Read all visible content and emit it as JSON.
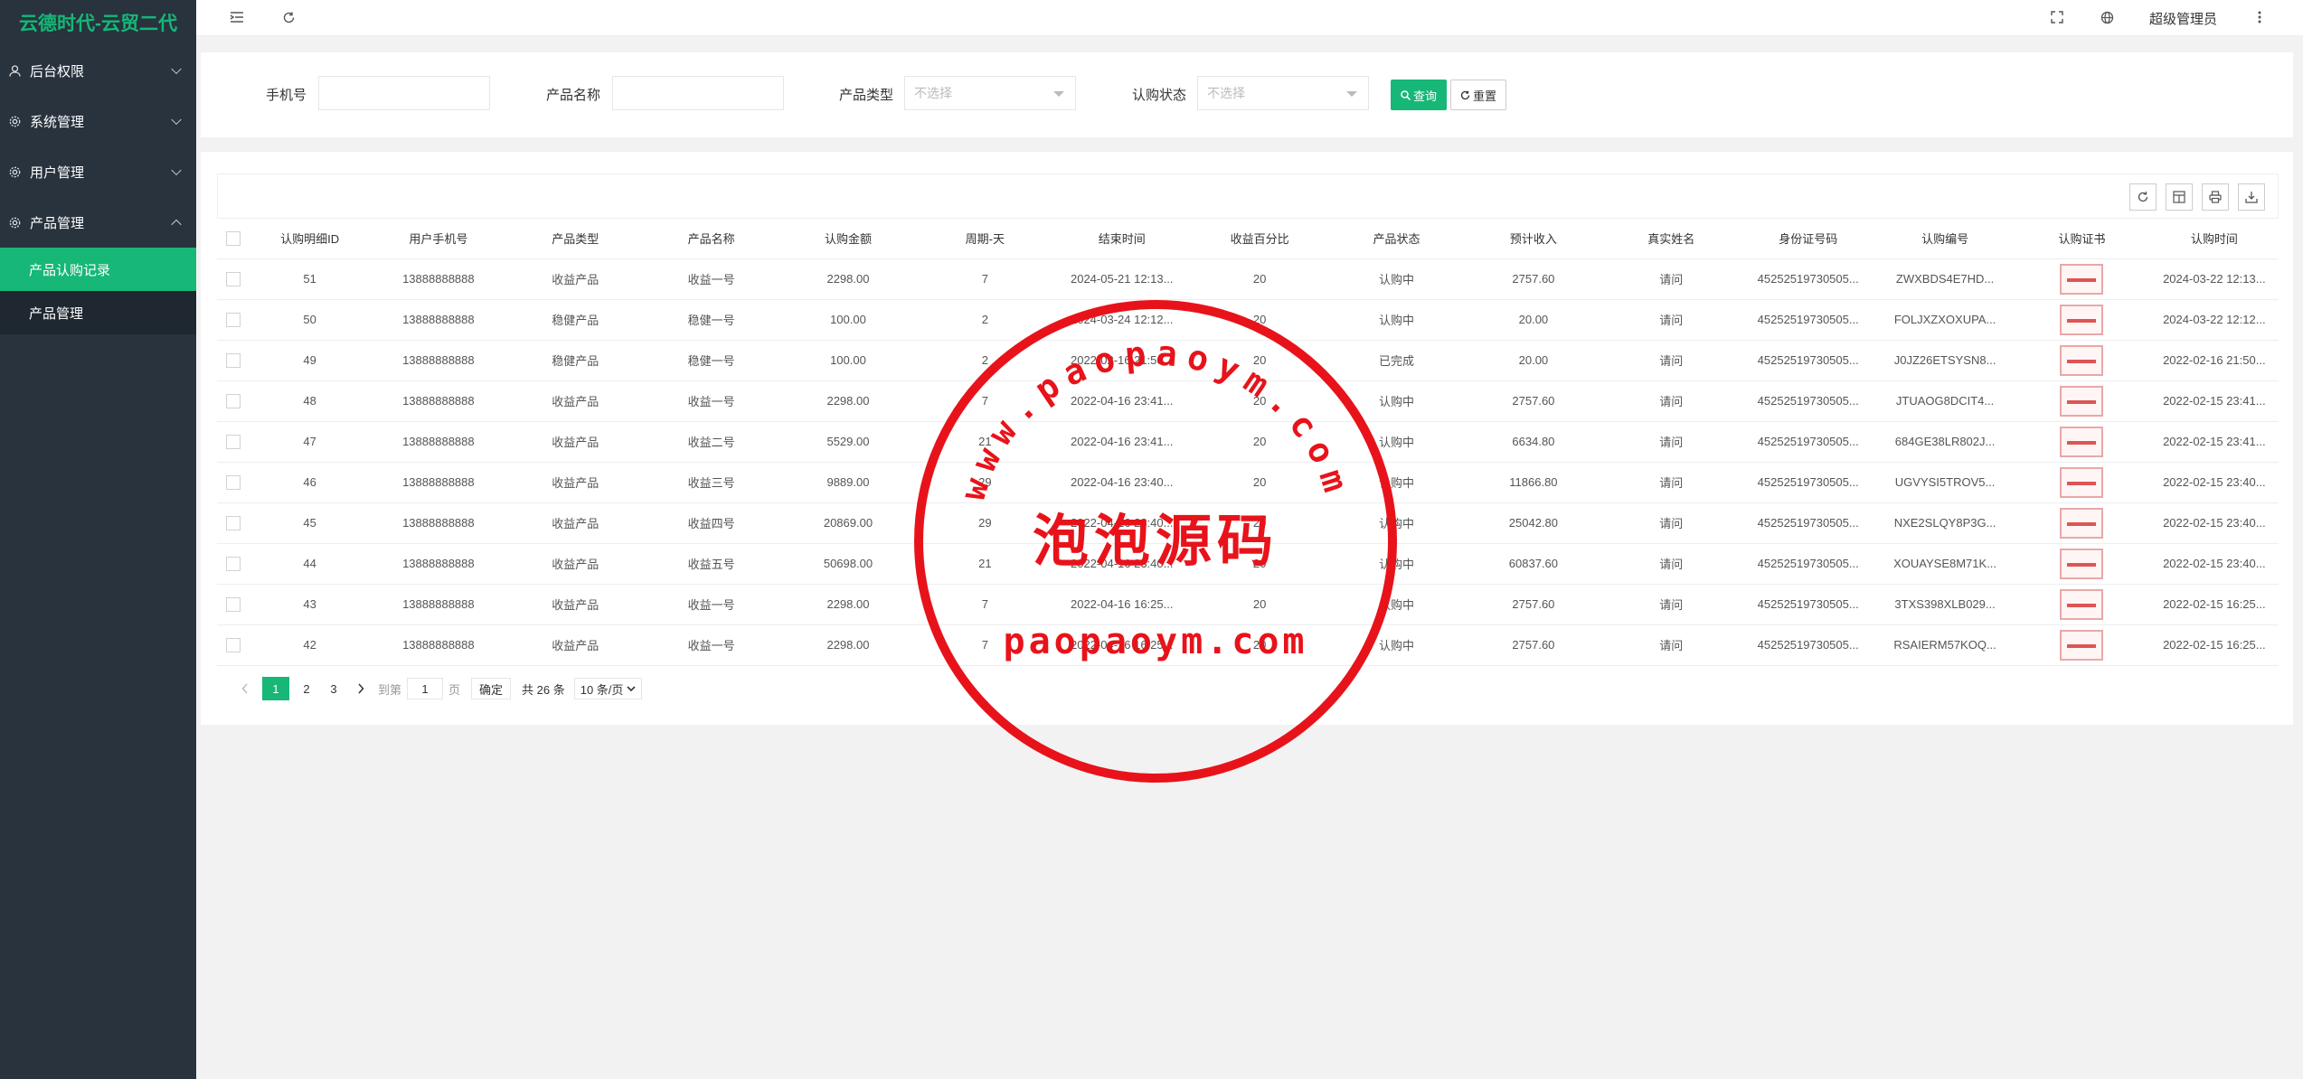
{
  "app": {
    "title": "云德时代-云贸二代",
    "user": "超级管理员"
  },
  "sidebar": {
    "items": [
      {
        "label": "后台权限"
      },
      {
        "label": "系统管理"
      },
      {
        "label": "用户管理"
      },
      {
        "label": "产品管理"
      }
    ],
    "children": [
      {
        "label": "产品认购记录"
      },
      {
        "label": "产品管理"
      }
    ]
  },
  "search": {
    "phone_label": "手机号",
    "product_name_label": "产品名称",
    "product_type_label": "产品类型",
    "product_type_placeholder": "不选择",
    "status_label": "认购状态",
    "status_placeholder": "不选择",
    "query_button": "查询",
    "reset_button": "重置"
  },
  "table": {
    "headers": [
      "认购明细ID",
      "用户手机号",
      "产品类型",
      "产品名称",
      "认购金额",
      "周期-天",
      "结束时间",
      "收益百分比",
      "产品状态",
      "预计收入",
      "真实姓名",
      "身份证号码",
      "认购编号",
      "认购证书",
      "认购时间"
    ],
    "rows": [
      [
        "51",
        "13888888888",
        "收益产品",
        "收益一号",
        "2298.00",
        "7",
        "2024-05-21 12:13...",
        "20",
        "认购中",
        "2757.60",
        "请问",
        "45252519730505...",
        "ZWXBDS4E7HD...",
        "",
        "2024-03-22 12:13..."
      ],
      [
        "50",
        "13888888888",
        "稳健产品",
        "稳健一号",
        "100.00",
        "2",
        "2024-03-24 12:12...",
        "20",
        "认购中",
        "20.00",
        "请问",
        "45252519730505...",
        "FOLJXZXOXUPA...",
        "",
        "2024-03-22 12:12..."
      ],
      [
        "49",
        "13888888888",
        "稳健产品",
        "稳健一号",
        "100.00",
        "2",
        "2022-02-16 21:50...",
        "20",
        "已完成",
        "20.00",
        "请问",
        "45252519730505...",
        "J0JZ26ETSYSN8...",
        "",
        "2022-02-16 21:50..."
      ],
      [
        "48",
        "13888888888",
        "收益产品",
        "收益一号",
        "2298.00",
        "7",
        "2022-04-16 23:41...",
        "20",
        "认购中",
        "2757.60",
        "请问",
        "45252519730505...",
        "JTUAOG8DCIT4...",
        "",
        "2022-02-15 23:41..."
      ],
      [
        "47",
        "13888888888",
        "收益产品",
        "收益二号",
        "5529.00",
        "21",
        "2022-04-16 23:41...",
        "20",
        "认购中",
        "6634.80",
        "请问",
        "45252519730505...",
        "684GE38LR802J...",
        "",
        "2022-02-15 23:41..."
      ],
      [
        "46",
        "13888888888",
        "收益产品",
        "收益三号",
        "9889.00",
        "29",
        "2022-04-16 23:40...",
        "20",
        "认购中",
        "11866.80",
        "请问",
        "45252519730505...",
        "UGVYSI5TROV5...",
        "",
        "2022-02-15 23:40..."
      ],
      [
        "45",
        "13888888888",
        "收益产品",
        "收益四号",
        "20869.00",
        "29",
        "2022-04-16 23:40...",
        "20",
        "认购中",
        "25042.80",
        "请问",
        "45252519730505...",
        "NXE2SLQY8P3G...",
        "",
        "2022-02-15 23:40..."
      ],
      [
        "44",
        "13888888888",
        "收益产品",
        "收益五号",
        "50698.00",
        "21",
        "2022-04-16 23:40...",
        "20",
        "认购中",
        "60837.60",
        "请问",
        "45252519730505...",
        "XOUAYSE8M71K...",
        "",
        "2022-02-15 23:40..."
      ],
      [
        "43",
        "13888888888",
        "收益产品",
        "收益一号",
        "2298.00",
        "7",
        "2022-04-16 16:25...",
        "20",
        "认购中",
        "2757.60",
        "请问",
        "45252519730505...",
        "3TXS398XLB029...",
        "",
        "2022-02-15 16:25..."
      ],
      [
        "42",
        "13888888888",
        "收益产品",
        "收益一号",
        "2298.00",
        "7",
        "2022-04-16 16:25...",
        "20",
        "认购中",
        "2757.60",
        "请问",
        "45252519730505...",
        "RSAIERM57KOQ...",
        "",
        "2022-02-15 16:25..."
      ]
    ]
  },
  "pager": {
    "pages": [
      "1",
      "2",
      "3"
    ],
    "goto_label": "到第",
    "page_input": "1",
    "page_unit": "页",
    "confirm": "确定",
    "total": "共 26 条",
    "page_size": "10 条/页"
  },
  "watermark": {
    "text_top": "www.paopaoym.com",
    "text_mid": "泡泡源码",
    "text_bottom": "paopaoym.com",
    "color": "#e8131a"
  }
}
